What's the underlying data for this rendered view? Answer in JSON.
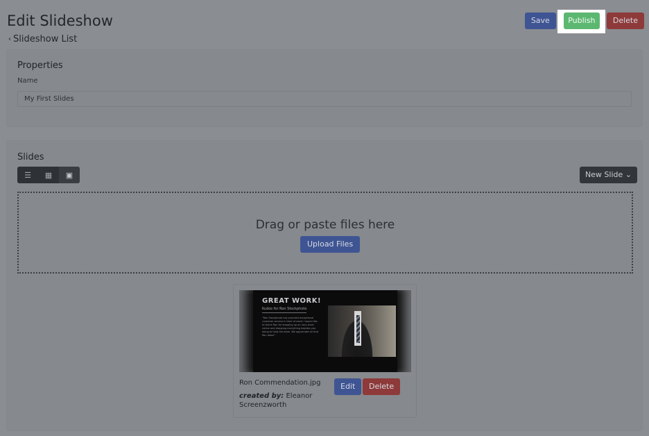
{
  "header": {
    "title": "Edit Slideshow",
    "back_label": "Slideshow List",
    "actions": {
      "save": "Save",
      "publish": "Publish",
      "delete": "Delete"
    }
  },
  "properties": {
    "title": "Properties",
    "name_label": "Name",
    "name_value": "My First Slides"
  },
  "slides": {
    "title": "Slides",
    "view_modes": [
      {
        "icon": "list-icon",
        "glyph": "☰",
        "active": false
      },
      {
        "icon": "small-grid-icon",
        "glyph": "▦",
        "active": false
      },
      {
        "icon": "large-grid-icon",
        "glyph": "▣",
        "active": true
      }
    ],
    "new_slide_label": "New Slide",
    "dropzone_text": "Drag or paste files here",
    "upload_label": "Upload Files",
    "items": [
      {
        "filename": "Ron Commendation.jpg",
        "created_by_label": "created by:",
        "created_by": "Eleanor Screenzworth",
        "edit_label": "Edit",
        "delete_label": "Delete",
        "thumbnail": {
          "heading": "GREAT WORK!",
          "subheading": "Kudos for Ron Stockphoto",
          "body": "\"Ron Stockphoto has provided exceptional customer service in time of need. I would like to thank Ron for stepping up on very short notice and dropping everything besides you doing to help the team. We appreciate all that Ron does!\""
        }
      }
    ]
  },
  "colors": {
    "primary": "#3f5493",
    "success": "#5cb870",
    "danger": "#8e3a3a",
    "dark": "#2e3236",
    "overlay": "#8a8d91"
  }
}
